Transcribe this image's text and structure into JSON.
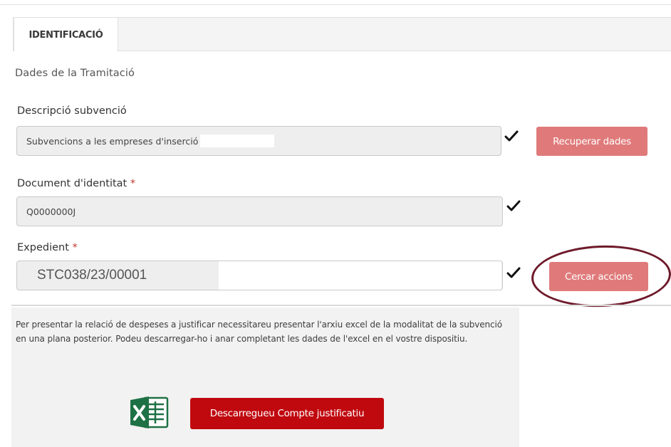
{
  "tabs": [
    {
      "label": "IDENTIFICACIÓ",
      "active": true
    }
  ],
  "section": {
    "title": "Dades de la Tramitació"
  },
  "fields": {
    "descripcio": {
      "label": "Descripció subvenció",
      "value": "Subvencions a les empreses d'inserció",
      "validated": true
    },
    "document": {
      "label": "Document d'identitat",
      "required_mark": "*",
      "value": "Q0000000J",
      "validated": true
    },
    "expedient": {
      "label": "Expedient",
      "required_mark": "*",
      "value": "STC038/23/00001",
      "validated": true
    }
  },
  "buttons": {
    "recuperar": "Recuperar dades",
    "cercar": "Cercar accions",
    "descarregar": "Descarregueu Compte justificatiu"
  },
  "info": {
    "text": "Per presentar la relació de despeses a justificar necessitareu presentar l'arxiu excel de la modalitat de la subvenció en una plana posterior. Podeu descarregar-ho i anar completant les dades de l'excel en el vostre dispositiu."
  },
  "icons": {
    "check": "check-icon",
    "excel": "excel-icon"
  },
  "colors": {
    "primary_button": "#c0090f",
    "secondary_button": "#e07a7a",
    "required": "#c0392b",
    "annotation_circle": "#6e1a2a",
    "excel_green": "#1e7145"
  }
}
